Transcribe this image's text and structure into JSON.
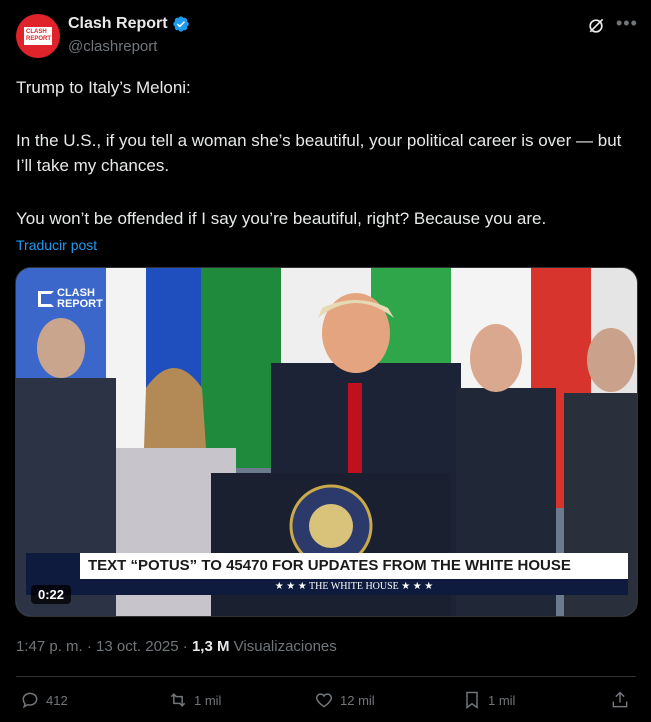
{
  "author": {
    "display_name": "Clash Report",
    "handle": "@clashreport",
    "avatar_text": "CLASH REPORT"
  },
  "tweet": {
    "paragraphs": [
      "Trump to Italy’s Meloni:",
      "In the U.S., if you tell a woman she’s beautiful, your political career is over — but I’ll take my chances.",
      "You won’t be offended if I say you’re beautiful, right? Because you are."
    ],
    "translate_label": "Traducir post"
  },
  "media": {
    "watermark_line1": "CLASH",
    "watermark_line2": "REPORT",
    "banner_text": "TEXT “POTUS” TO 45470 FOR UPDATES FROM THE WHITE HOUSE",
    "banner_sub": "★ ★ ★   THE WHITE HOUSE   ★ ★ ★",
    "duration": "0:22"
  },
  "meta": {
    "time": "1:47 p. m.",
    "date": "13 oct. 2025",
    "views_count": "1,3 M",
    "views_label": "Visualizaciones"
  },
  "actions": {
    "replies": "412",
    "reposts": "1 mil",
    "likes": "12 mil",
    "bookmarks": "1 mil"
  },
  "colors": {
    "background": "#000000",
    "text": "#e7e9ea",
    "secondary": "#71767b",
    "accent": "#1d9bf0",
    "avatar": "#e0222b"
  },
  "icons": [
    "verified-badge-icon",
    "grok-icon",
    "more-icon",
    "reply-icon",
    "repost-icon",
    "like-icon",
    "bookmark-icon",
    "share-icon"
  ]
}
